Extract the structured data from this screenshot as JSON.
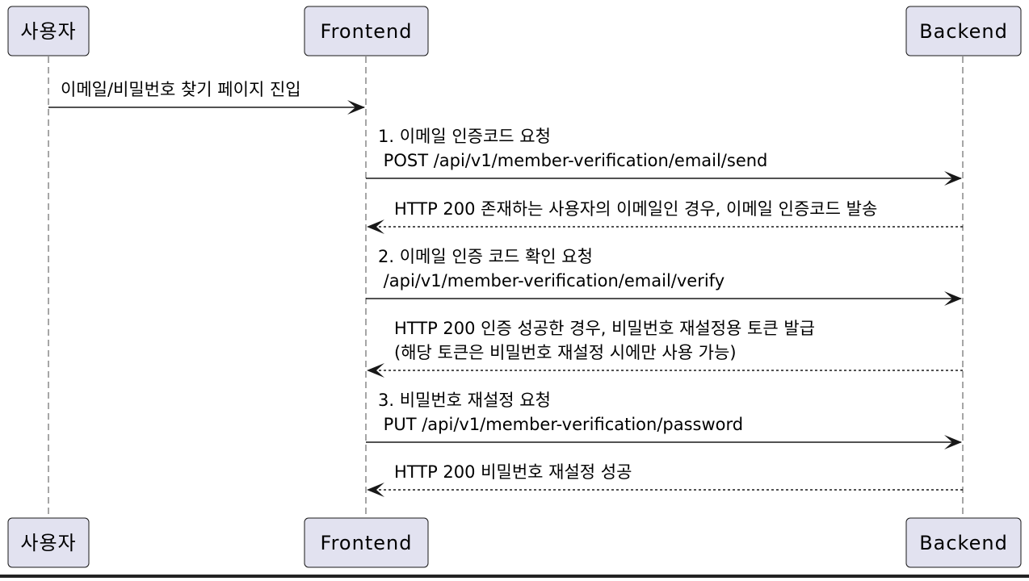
{
  "colors": {
    "participant_fill": "#E2E2F0",
    "participant_stroke": "#181818",
    "lifeline": "#888888",
    "arrow": "#181818"
  },
  "participants": [
    {
      "id": "user",
      "label": "사용자"
    },
    {
      "id": "frontend",
      "label": "Frontend"
    },
    {
      "id": "backend",
      "label": "Backend"
    }
  ],
  "messages": [
    {
      "from": "user",
      "to": "frontend",
      "style": "solid",
      "lines": [
        "이메일/비밀번호 찾기 페이지 진입"
      ]
    },
    {
      "from": "frontend",
      "to": "backend",
      "style": "solid",
      "lines": [
        "1. 이메일 인증코드 요청",
        " POST /api/v1/member-verification/email/send"
      ]
    },
    {
      "from": "backend",
      "to": "frontend",
      "style": "dashed",
      "lines": [
        "HTTP 200 존재하는 사용자의 이메일인 경우, 이메일 인증코드 발송"
      ]
    },
    {
      "from": "frontend",
      "to": "backend",
      "style": "solid",
      "lines": [
        "2. 이메일 인증 코드 확인 요청",
        " /api/v1/member-verification/email/verify"
      ]
    },
    {
      "from": "backend",
      "to": "frontend",
      "style": "dashed",
      "lines": [
        "HTTP 200 인증 성공한 경우, 비밀번호 재설정용 토큰 발급",
        "(해당 토큰은 비밀번호 재설정 시에만 사용 가능)"
      ]
    },
    {
      "from": "frontend",
      "to": "backend",
      "style": "solid",
      "lines": [
        "3. 비밀번호 재설정 요청",
        " PUT /api/v1/member-verification/password"
      ]
    },
    {
      "from": "backend",
      "to": "frontend",
      "style": "dashed",
      "lines": [
        "HTTP 200 비밀번호 재설정 성공"
      ]
    }
  ]
}
